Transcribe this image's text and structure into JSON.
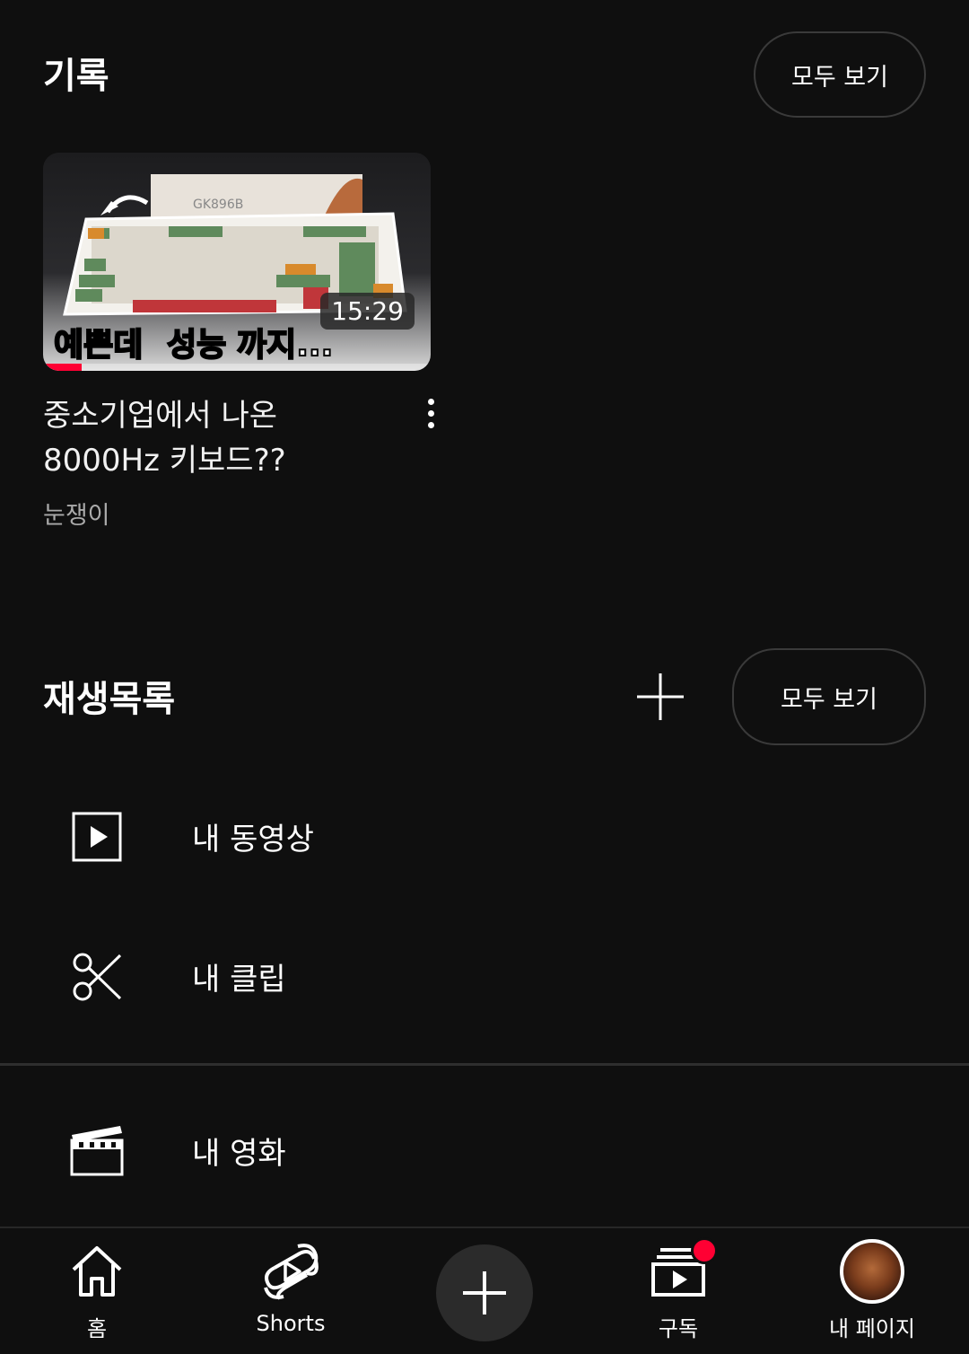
{
  "history": {
    "title": "기록",
    "view_all": "모두 보기",
    "video": {
      "duration": "15:29",
      "progress_percent": 10,
      "title": "중소기업에서 나온 8000Hz 키보드??",
      "channel": "눈쟁이",
      "thumbnail_text_1": "예쁜데",
      "thumbnail_text_2": "성능",
      "thumbnail_text_3": "까지...",
      "thumbnail_brand": "GK896B"
    }
  },
  "playlists": {
    "title": "재생목록",
    "view_all": "모두 보기",
    "items": [
      {
        "label": "내 동영상",
        "icon": "play-box-icon"
      },
      {
        "label": "내 클립",
        "icon": "scissors-icon"
      },
      {
        "label": "내 영화",
        "icon": "clapperboard-icon"
      }
    ]
  },
  "bottom_nav": {
    "items": [
      {
        "label": "홈",
        "icon": "home-icon"
      },
      {
        "label": "Shorts",
        "icon": "shorts-icon"
      },
      {
        "label": "",
        "icon": "plus-icon"
      },
      {
        "label": "구독",
        "icon": "subscriptions-icon"
      },
      {
        "label": "내 페이지",
        "icon": "avatar"
      }
    ]
  },
  "colors": {
    "background": "#0f0f0f",
    "accent": "#ff0033",
    "text_secondary": "#aaaaaa"
  }
}
